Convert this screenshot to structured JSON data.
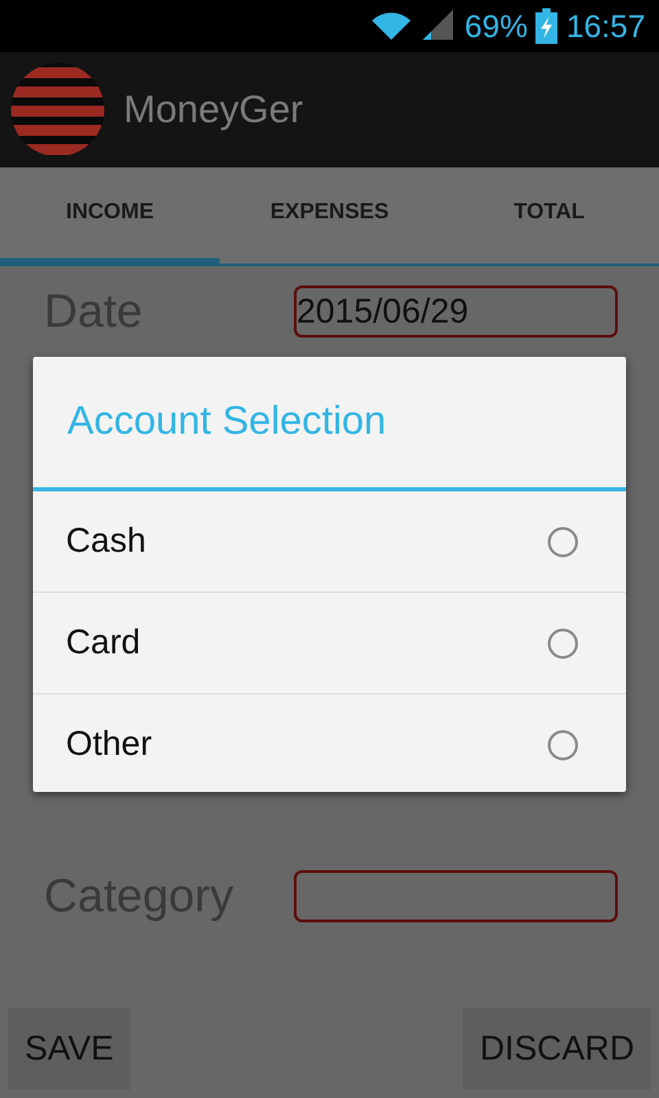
{
  "status_bar": {
    "battery": "69%",
    "time": "16:57"
  },
  "app_bar": {
    "title": "MoneyGer"
  },
  "tabs": [
    {
      "label": "INCOME",
      "selected": true
    },
    {
      "label": "EXPENSES",
      "selected": false
    },
    {
      "label": "TOTAL",
      "selected": false
    }
  ],
  "form": [
    {
      "label": "Date",
      "value": "2015/06/29"
    },
    {
      "label": "Category"
    }
  ],
  "buttons": [
    "SAVE",
    "DISCARD"
  ],
  "dialog": {
    "title": "Account Selection",
    "options": [
      {
        "label": "Cash",
        "selected": false
      },
      {
        "label": "Card",
        "selected": false
      },
      {
        "label": "Other",
        "selected": false
      }
    ]
  }
}
